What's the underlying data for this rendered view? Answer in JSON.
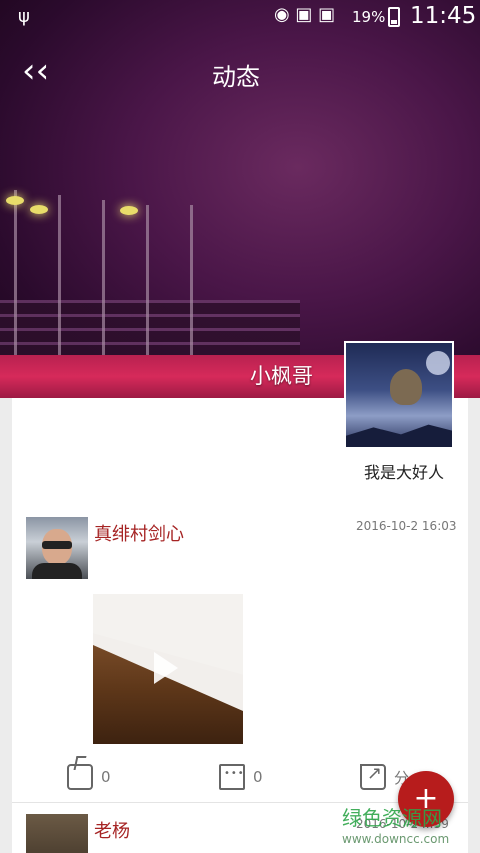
{
  "status_bar": {
    "usb_icon": "usb-icon",
    "battery_percent": "19%",
    "time": "11:45"
  },
  "header": {
    "title": "动态",
    "back_icon": "back-arrow-icon"
  },
  "profile": {
    "name": "小枫哥",
    "signature": "我是大好人"
  },
  "feed": {
    "posts": [
      {
        "author": "真绯村剑心",
        "time": "2016-10-2 16:03",
        "likes": "0",
        "comments": "0",
        "share_label": "分"
      },
      {
        "author": "老杨",
        "time": "2016-10-2 ..:59"
      }
    ]
  },
  "fab": {
    "label": "+"
  },
  "watermark": {
    "text": "绿色资源网",
    "url": "www.downcc.com"
  },
  "colors": {
    "accent": "#b71c1c",
    "author": "#a62424"
  }
}
